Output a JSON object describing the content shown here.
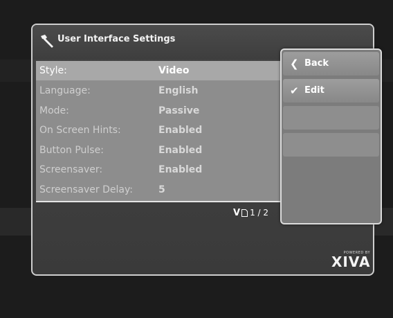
{
  "dialog": {
    "title": "User Interface Settings",
    "title_icon": "wrench-icon"
  },
  "settings": [
    {
      "label": "Style:",
      "value": "Video",
      "selected": true
    },
    {
      "label": "Language:",
      "value": "English"
    },
    {
      "label": "Mode:",
      "value": "Passive"
    },
    {
      "label": "On Screen Hints:",
      "value": "Enabled"
    },
    {
      "label": "Button Pulse:",
      "value": "Enabled"
    },
    {
      "label": "Screensaver:",
      "value": "Enabled"
    },
    {
      "label": "Screensaver Delay:",
      "value": "5"
    }
  ],
  "pager": {
    "scroll_icon": "chevron-down-icon",
    "page_icon": "page-icon",
    "text": "1 / 2"
  },
  "actions": {
    "back": {
      "label": "Back",
      "icon": "chevron-left-icon"
    },
    "edit": {
      "label": "Edit",
      "icon": "checkmark-icon"
    }
  },
  "branding": {
    "powered_by": "POWERED BY",
    "brand": "XIVA"
  }
}
